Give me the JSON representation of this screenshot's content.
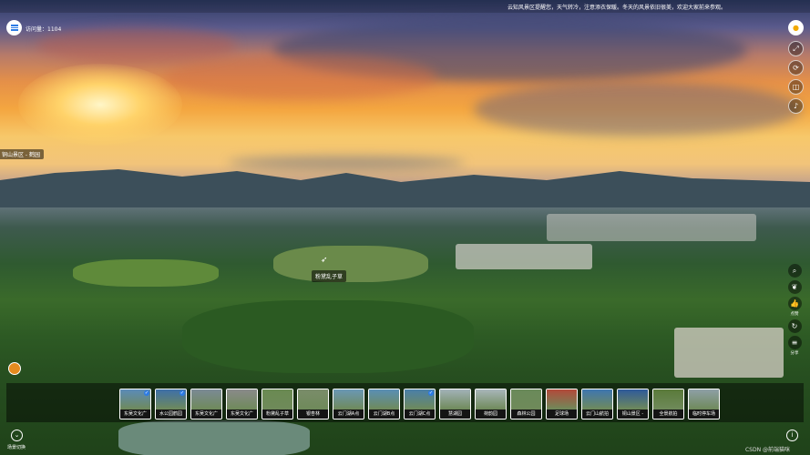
{
  "header": {
    "notice": "云知风景区提醒您，天气转冷，注意添衣保暖。冬天的风景依旧很美，欢迎大家前来参观。",
    "views_label": "访问量：1104"
  },
  "scene_tag": "铜山景区 - 鹤园",
  "hotspot": {
    "label": "粉黛乱子草"
  },
  "right_toolbar": [
    {
      "name": "location-icon",
      "glyph": "●"
    },
    {
      "name": "fullscreen-icon",
      "glyph": "⤢"
    },
    {
      "name": "rotate-icon",
      "glyph": "⟳"
    },
    {
      "name": "vr-icon",
      "glyph": "◫"
    },
    {
      "name": "mic-icon",
      "glyph": "♪"
    }
  ],
  "mid_toolbar": [
    {
      "name": "search-icon",
      "glyph": "⌕",
      "label": ""
    },
    {
      "name": "thermometer-icon",
      "glyph": "❦",
      "label": ""
    },
    {
      "name": "like-icon",
      "glyph": "👍",
      "label": "点赞"
    },
    {
      "name": "comment-icon",
      "glyph": "↻",
      "label": ""
    },
    {
      "name": "share-icon",
      "glyph": "≡",
      "label": "分享"
    }
  ],
  "thumbnails": [
    {
      "label": "东吴文化广",
      "checked": true,
      "color": "#5b8bb8"
    },
    {
      "label": "水公园鹤园",
      "checked": true,
      "color": "#3e6fa8"
    },
    {
      "label": "东吴文化广",
      "checked": false,
      "color": "#7b8a95"
    },
    {
      "label": "东吴文化广",
      "checked": false,
      "color": "#8a8a8a"
    },
    {
      "label": "粉黛乱子草",
      "checked": false,
      "color": "#6a8a52"
    },
    {
      "label": "银杏林",
      "checked": false,
      "color": "#7a8c6a"
    },
    {
      "label": "云门湖A点",
      "checked": false,
      "color": "#6a98b5"
    },
    {
      "label": "云门湖B点",
      "checked": false,
      "color": "#5a8fb5"
    },
    {
      "label": "云门湖C点",
      "checked": true,
      "color": "#4a7fa8"
    },
    {
      "label": "慧湖园",
      "checked": false,
      "color": "#a2b2b8"
    },
    {
      "label": "荷韵园",
      "checked": false,
      "color": "#a8b6ba"
    },
    {
      "label": "森林公园",
      "checked": false,
      "color": "#6a8a5a"
    },
    {
      "label": "足球场",
      "checked": false,
      "color": "#b24a3a"
    },
    {
      "label": "云门山航拍",
      "checked": false,
      "color": "#3f76b0"
    },
    {
      "label": "铜山景区 -",
      "checked": false,
      "color": "#2f5a9a"
    },
    {
      "label": "全景航拍",
      "checked": false,
      "color": "#5a7a3a"
    },
    {
      "label": "临时停车场",
      "checked": false,
      "color": "#8ea0a6"
    }
  ],
  "bottom": {
    "scenes_label": "场景切换",
    "credit": "CSDN @前端猫咪"
  }
}
